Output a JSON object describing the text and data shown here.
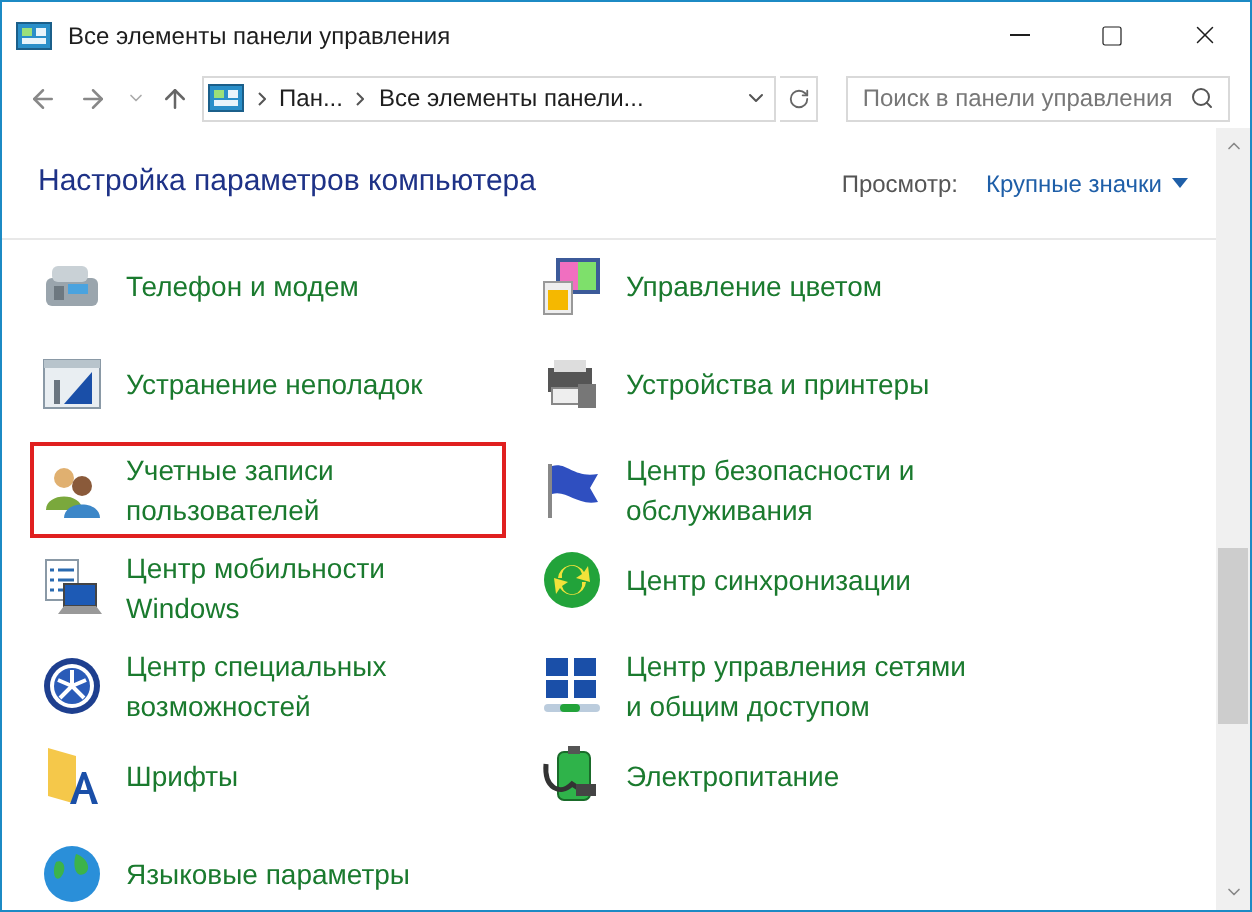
{
  "window": {
    "title": "Все элементы панели управления"
  },
  "address_bar": {
    "segments": [
      "Пан...",
      "Все элементы панели..."
    ]
  },
  "search": {
    "placeholder": "Поиск в панели управления"
  },
  "header": {
    "title": "Настройка параметров компьютера",
    "view_label": "Просмотр:",
    "view_value": "Крупные значки"
  },
  "items": [
    {
      "kind": "phone",
      "label": "Телефон и модем",
      "highlighted": false
    },
    {
      "kind": "color",
      "label": "Управление цветом",
      "highlighted": false
    },
    {
      "kind": "troubleshoot",
      "label": "Устранение неполадок",
      "highlighted": false
    },
    {
      "kind": "printer",
      "label": "Устройства и принтеры",
      "highlighted": false
    },
    {
      "kind": "users",
      "label": "Учетные записи пользователей",
      "highlighted": true
    },
    {
      "kind": "flag",
      "label": "Центр безопасности и обслуживания",
      "highlighted": false
    },
    {
      "kind": "mobility",
      "label": "Центр мобильности Windows",
      "highlighted": false
    },
    {
      "kind": "sync",
      "label": "Центр синхронизации",
      "highlighted": false
    },
    {
      "kind": "access",
      "label": "Центр специальных возможностей",
      "highlighted": false
    },
    {
      "kind": "network",
      "label": "Центр управления сетями и общим доступом",
      "highlighted": false
    },
    {
      "kind": "fonts",
      "label": "Шрифты",
      "highlighted": false
    },
    {
      "kind": "power",
      "label": "Электропитание",
      "highlighted": false
    },
    {
      "kind": "globe",
      "label": "Языковые параметры",
      "highlighted": false
    }
  ]
}
